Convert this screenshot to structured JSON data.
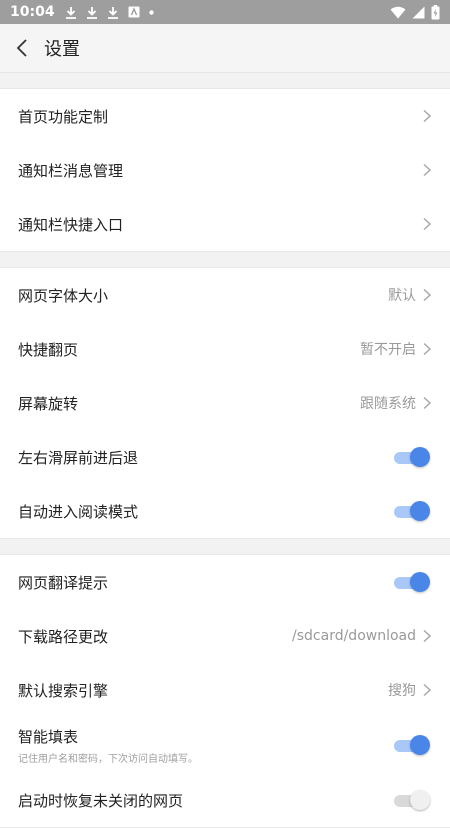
{
  "status_bar": {
    "time": "10:04",
    "icons": [
      "download-icon",
      "download-icon",
      "download-icon",
      "app-notification-icon",
      "dot-icon",
      "wifi-icon",
      "signal-icon",
      "battery-icon"
    ]
  },
  "app_bar": {
    "title": "设置",
    "back_icon": "chevron-left-icon"
  },
  "groups": {
    "home": [
      {
        "label": "首页功能定制"
      },
      {
        "label": "通知栏消息管理"
      },
      {
        "label": "通知栏快捷入口"
      }
    ],
    "browse": [
      {
        "label": "网页字体大小",
        "value": "默认"
      },
      {
        "label": "快捷翻页",
        "value": "暂不开启"
      },
      {
        "label": "屏幕旋转",
        "value": "跟随系统"
      },
      {
        "label": "左右滑屏前进后退",
        "toggle": true
      },
      {
        "label": "自动进入阅读模式",
        "toggle": true
      }
    ],
    "misc": [
      {
        "label": "网页翻译提示",
        "toggle": true
      },
      {
        "label": "下载路径更改",
        "value": "/sdcard/download"
      },
      {
        "label": "默认搜索引擎",
        "value": "搜狗"
      },
      {
        "label": "智能填表",
        "sublabel": "记住用户名和密码，下次访问自动填写。",
        "toggle": true
      },
      {
        "label": "启动时恢复未关闭的网页",
        "toggle": false
      }
    ]
  },
  "colors": {
    "accent": "#4a86e8",
    "accent_track": "#a9c7f7",
    "status_bar": "#9e9e9e"
  }
}
